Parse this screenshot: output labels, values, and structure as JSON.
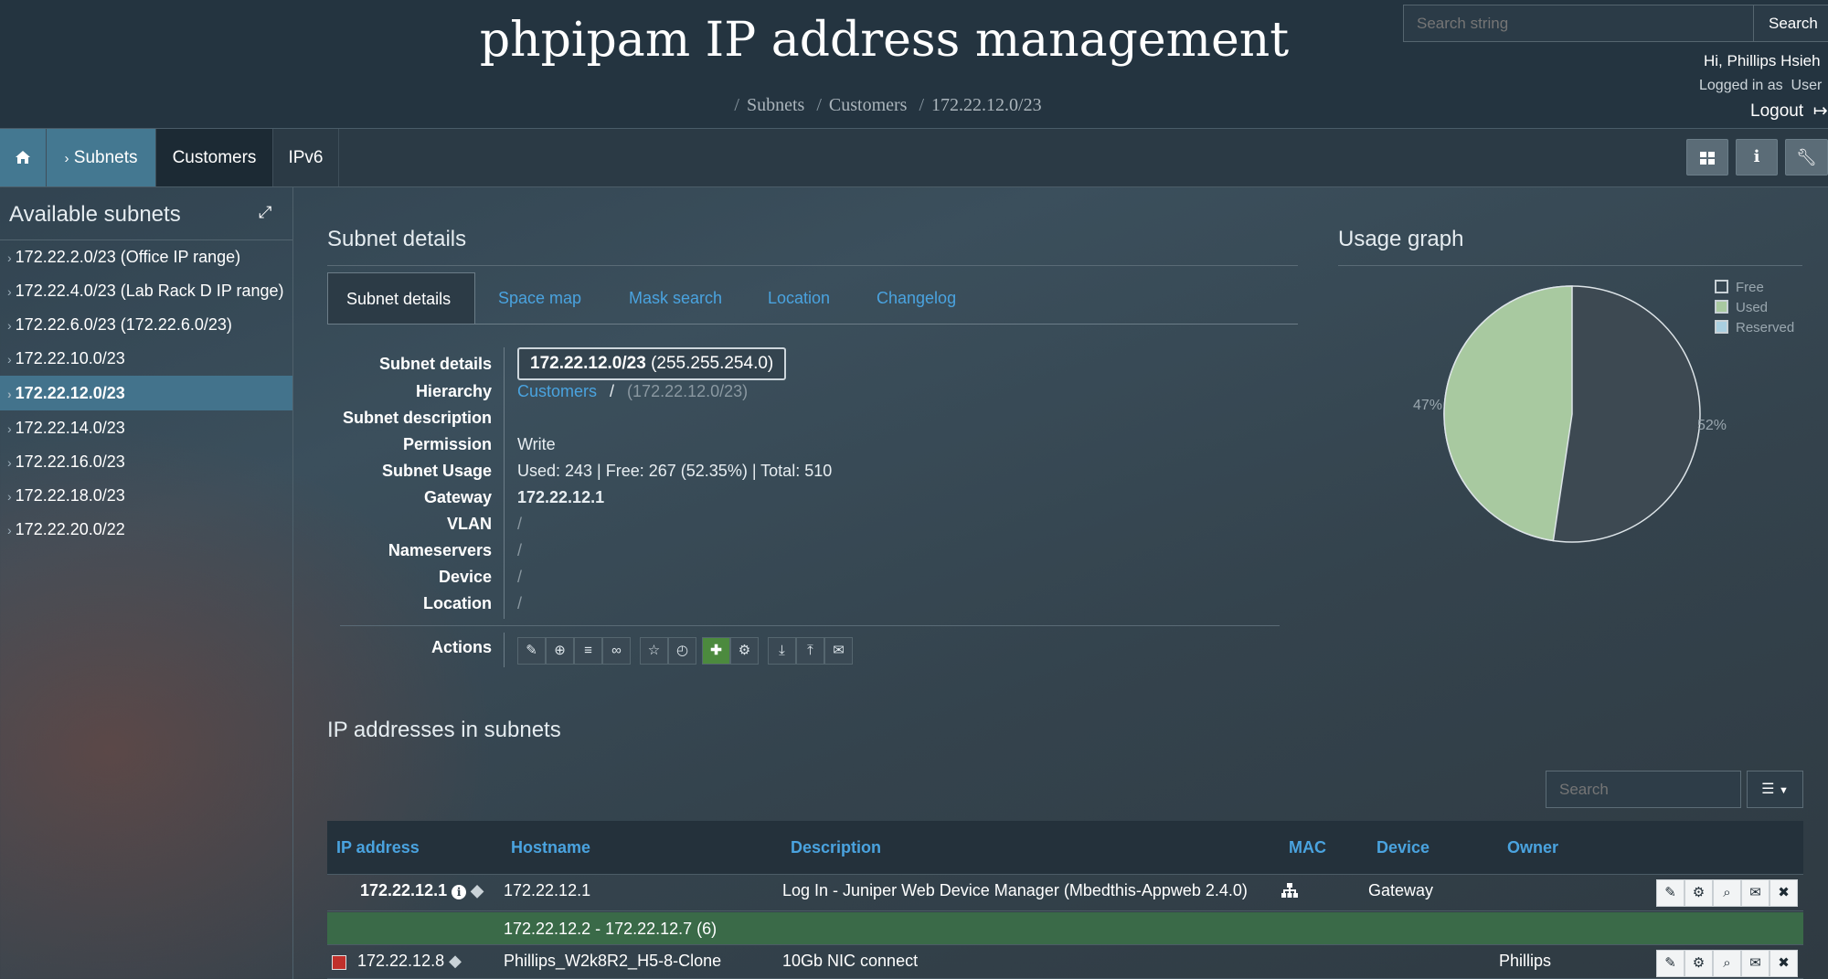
{
  "header": {
    "title": "phpipam IP address management",
    "breadcrumb": [
      "Subnets",
      "Customers",
      "172.22.12.0/23"
    ],
    "search_placeholder": "Search string",
    "search_button": "Search",
    "greeting": "Hi, Phillips Hsieh",
    "logged_in_label": "Logged in as",
    "logged_in_role": "User",
    "logout": "Logout"
  },
  "nav": {
    "items": [
      {
        "label": "Home",
        "icon": "home-icon"
      },
      {
        "label": "Subnets",
        "icon": "chevron-right-icon"
      },
      {
        "label": "Customers"
      },
      {
        "label": "IPv6"
      }
    ],
    "tools": [
      "grid-icon",
      "info-icon",
      "wrench-icon"
    ]
  },
  "sidebar": {
    "title": "Available subnets",
    "items": [
      "172.22.2.0/23 (Office IP range)",
      "172.22.4.0/23 (Lab Rack D IP range)",
      "172.22.6.0/23 (172.22.6.0/23)",
      "172.22.10.0/23",
      "172.22.12.0/23",
      "172.22.14.0/23",
      "172.22.16.0/23",
      "172.22.18.0/23",
      "172.22.20.0/22"
    ],
    "active_index": 4
  },
  "details": {
    "section_title": "Subnet details",
    "tabs": [
      "Subnet details",
      "Space map",
      "Mask search",
      "Location",
      "Changelog"
    ],
    "labels": {
      "subnet": "Subnet details",
      "hierarchy": "Hierarchy",
      "description": "Subnet description",
      "permission": "Permission",
      "usage": "Subnet Usage",
      "gateway": "Gateway",
      "vlan": "VLAN",
      "nameservers": "Nameservers",
      "device": "Device",
      "location": "Location",
      "actions": "Actions"
    },
    "values": {
      "subnet": "172.22.12.0/23",
      "mask": "(255.255.254.0)",
      "hierarchy_link": "Customers",
      "hierarchy_sep": "/",
      "hierarchy_current": "(172.22.12.0/23)",
      "permission": "Write",
      "usage": "Used: 243 | Free: 267 (52.35%) | Total: 510",
      "gateway": "172.22.12.1",
      "vlan": "/",
      "nameservers": "/",
      "device": "/",
      "location": "/"
    }
  },
  "usage_graph": {
    "title": "Usage graph",
    "legend": [
      "Free",
      "Used",
      "Reserved"
    ],
    "colors": {
      "free": "#3d4952",
      "used": "#a8c9a0",
      "reserved": "#a9cfe0",
      "border": "#dde4e8"
    },
    "used_fraction": 0.4765,
    "labels": {
      "used": "47%",
      "free": "52%"
    }
  },
  "ip_table": {
    "section_title": "IP addresses in subnets",
    "search_placeholder": "Search",
    "columns": [
      "IP address",
      "Hostname",
      "Description",
      "MAC",
      "Device",
      "Owner"
    ],
    "rows": [
      {
        "ip": "172.22.12.1",
        "hostname": "172.22.12.1",
        "description": "Log In - Juniper Web Device Manager (Mbedthis-Appweb 2.4.0)",
        "device": "Gateway",
        "owner": ""
      },
      {
        "range": "172.22.12.2 - 172.22.12.7 (6)"
      },
      {
        "ip": "172.22.12.8",
        "hostname": "Phillips_W2k8R2_H5-8-Clone",
        "description": "10Gb NIC connect",
        "device": "",
        "owner": "Phillips"
      }
    ]
  }
}
